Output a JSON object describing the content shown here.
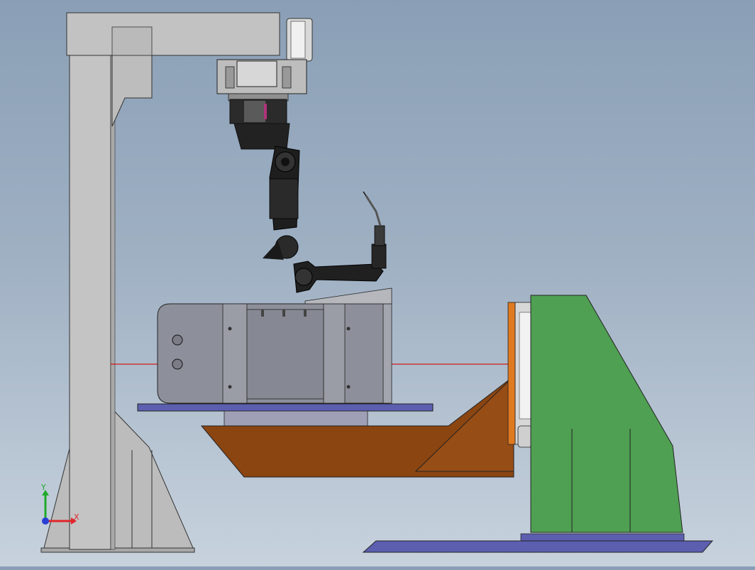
{
  "viewport": {
    "background_top": "#8a9fb6",
    "background_bottom": "#c7d2dd",
    "scene": {
      "gantry_color": "#b9b9b9",
      "robot_color": "#1e1e1e",
      "workpiece_color": "#8c8f99",
      "fixture_plate_color": "#5c5fb0",
      "positioner_arm_color": "#8b4511",
      "positioner_base_color": "#4fa052",
      "faceplate_color": "#e07a20",
      "rotation_axis_color": "#d11a1a"
    }
  },
  "triad": {
    "x_label": "X",
    "y_label": "Y",
    "x_color": "#e0262b",
    "y_color": "#1faa2a",
    "z_color": "#2a3fd6"
  }
}
